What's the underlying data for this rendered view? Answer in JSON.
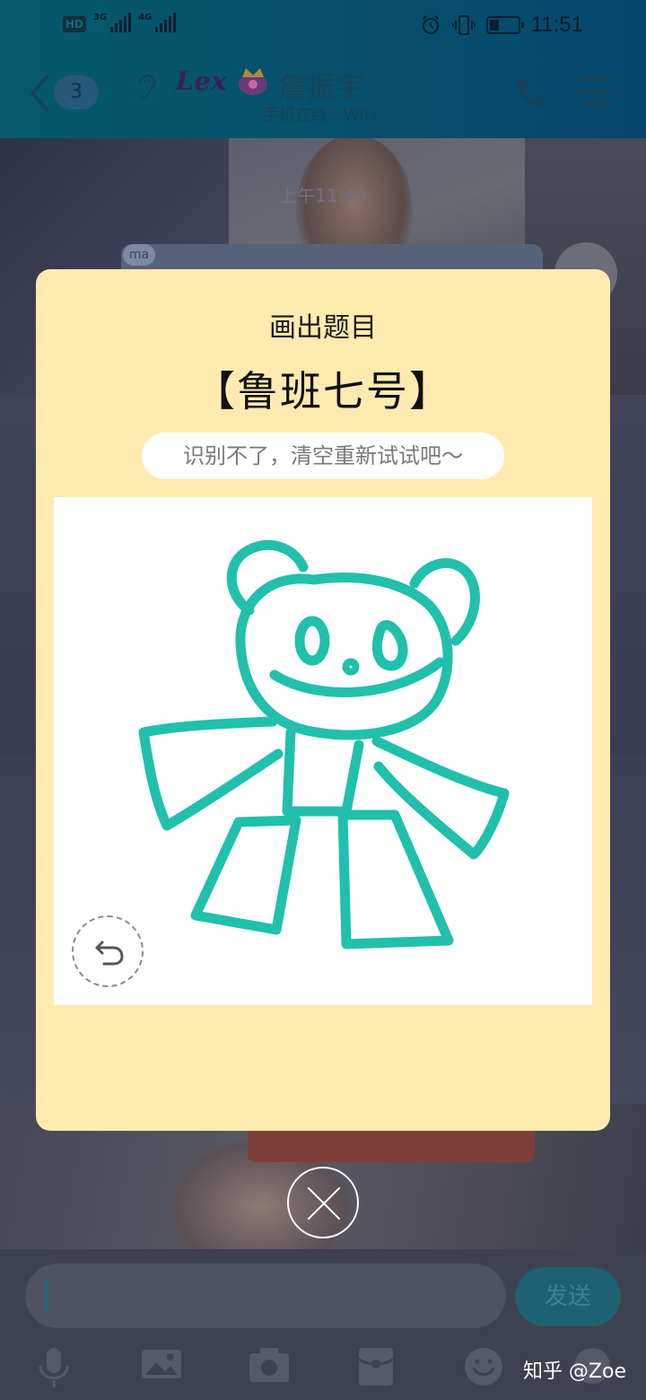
{
  "status_bar": {
    "network_hd": "HD",
    "network_3g": "3G",
    "network_4g": "4G",
    "time": "11:51"
  },
  "chat_header": {
    "unread_count": "3",
    "contact_name": "詹振宇",
    "contact_status": "手机在线 - WiFi",
    "logo_text": "Lex"
  },
  "chat_background": {
    "timestamp": "上午11:49",
    "sender_tag": "ma"
  },
  "drawing_game": {
    "title": "画出题目",
    "prompt_word": "【鲁班七号】",
    "hint": "识别不了，清空重新试试吧～",
    "stroke_color": "#20c0ad",
    "modal_color": "#ffebb0"
  },
  "input_bar": {
    "send_label": "发送",
    "tools": [
      "microphone-icon",
      "image-icon",
      "camera-icon",
      "red-packet-icon",
      "emoji-icon",
      "more-icon"
    ]
  },
  "watermark": "知乎 @Zoe"
}
